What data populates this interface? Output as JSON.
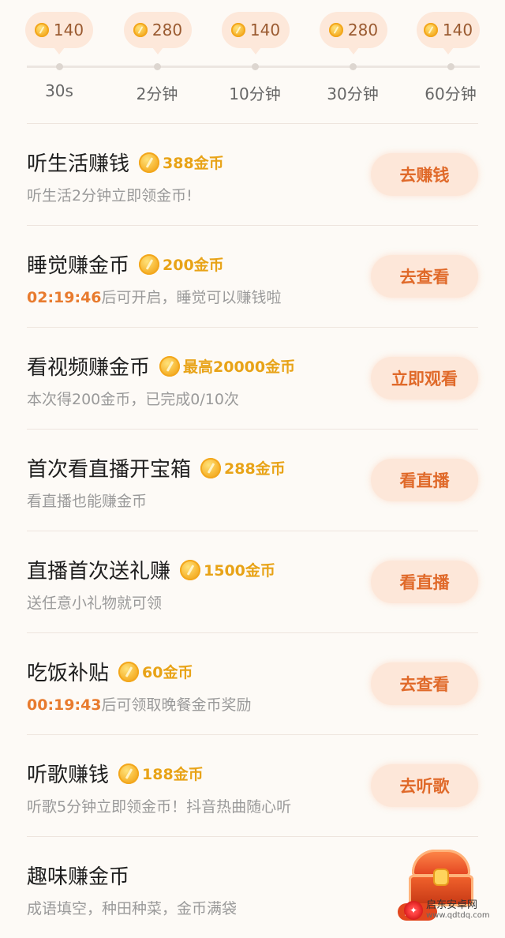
{
  "timeline": {
    "bubbles": [
      {
        "amount": "140"
      },
      {
        "amount": "280"
      },
      {
        "amount": "140"
      },
      {
        "amount": "280"
      },
      {
        "amount": "140"
      }
    ],
    "ticks": [
      "30s",
      "2分钟",
      "10分钟",
      "30分钟",
      "60分钟"
    ]
  },
  "tasks": [
    {
      "title": "听生活赚钱",
      "reward": "388金币",
      "desc": "听生活2分钟立即领金币!",
      "button": "去赚钱"
    },
    {
      "title": "睡觉赚金币",
      "reward": "200金币",
      "countdown": "02:19:46",
      "desc": "后可开启，睡觉可以赚钱啦",
      "button": "去查看"
    },
    {
      "title": "看视频赚金币",
      "reward": "最高20000金币",
      "desc": "本次得200金币，已完成0/10次",
      "button": "立即观看"
    },
    {
      "title": "首次看直播开宝箱",
      "reward": "288金币",
      "desc": "看直播也能赚金币",
      "button": "看直播"
    },
    {
      "title": "直播首次送礼赚",
      "reward": "1500金币",
      "desc": "送任意小礼物就可领",
      "button": "看直播"
    },
    {
      "title": "吃饭补贴",
      "reward": "60金币",
      "countdown": "00:19:43",
      "desc": "后可领取晚餐金币奖励",
      "button": "去查看"
    },
    {
      "title": "听歌赚钱",
      "reward": "188金币",
      "desc": "听歌5分钟立即领金币！抖音热曲随心听",
      "button": "去听歌"
    },
    {
      "title": "趣味赚金币",
      "desc": "成语填空，种田种菜，金币满袋",
      "chest_badge": "5"
    }
  ],
  "watermark": {
    "name": "启东安卓网",
    "url": "www.qdtdq.com"
  },
  "colors": {
    "accent": "#e06a2a",
    "coin": "#f7b733",
    "reward_text": "#e8a317",
    "button_bg": "#fde7d9"
  }
}
